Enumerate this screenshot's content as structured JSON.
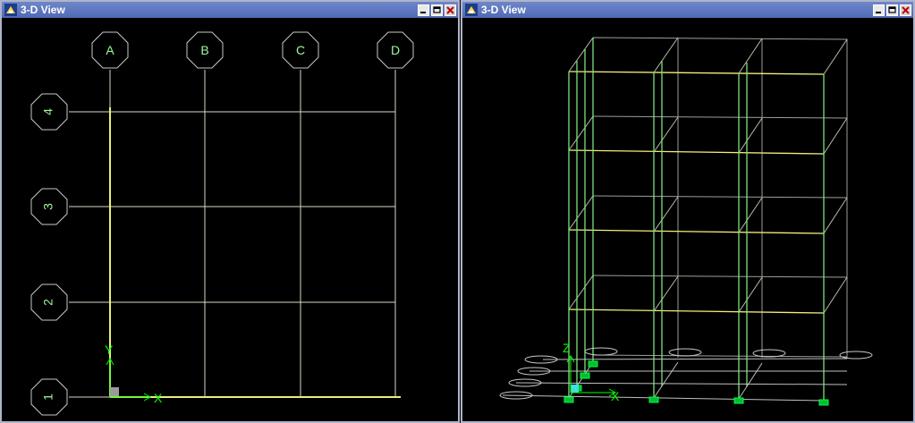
{
  "windows": [
    {
      "title": "3-D View"
    },
    {
      "title": "3-D View"
    }
  ],
  "plan_view": {
    "grid_x_labels": [
      "A",
      "B",
      "C",
      "D"
    ],
    "grid_y_labels": [
      "1",
      "2",
      "3",
      "4"
    ],
    "axis_labels": {
      "x": "X",
      "y": "Y"
    }
  },
  "iso_view": {
    "axis_labels": {
      "z": "Z",
      "x": "X"
    }
  },
  "colors": {
    "title_bar": "#5b73bf",
    "grid_line": "#d8d8c8",
    "axis": "#00ff00",
    "frame": "#7fe07f",
    "beam": "#f0f080",
    "support": "#00cc33"
  }
}
